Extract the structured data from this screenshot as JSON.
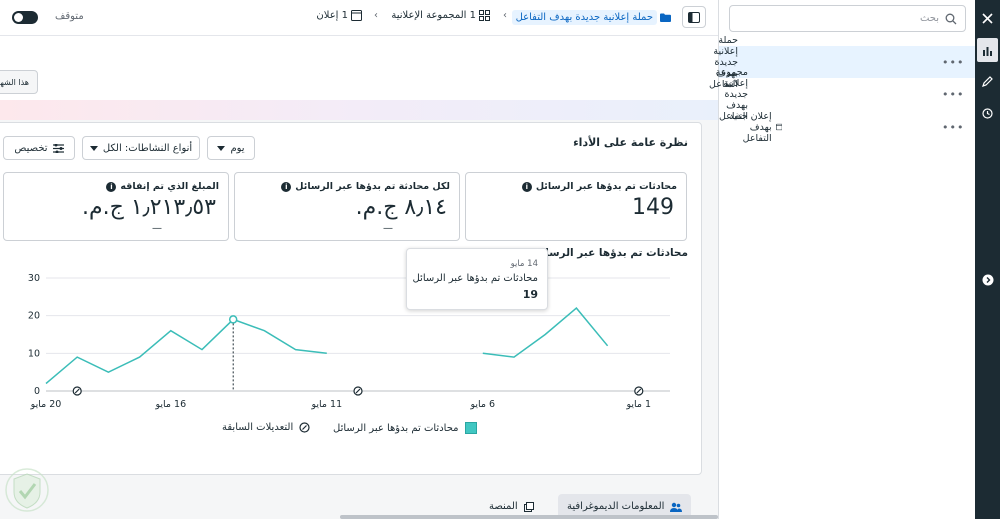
{
  "topbar": {
    "status_label": "متوقف",
    "breadcrumb": {
      "campaign": "حملة إعلانية جديدة بهدف التفاعل",
      "ad_set": "1 المجموعة الإعلانية",
      "ad": "1 إعلان"
    },
    "month_button": "هذا الشهر"
  },
  "nav": {
    "search_placeholder": "بحث",
    "items": [
      {
        "label": "حملة إعلانية جديدة بهدف التفاعل",
        "icon": "folder-icon"
      },
      {
        "label": "مجموعة إعلانية جديدة بهدف التفاعل",
        "icon": "grid-icon"
      },
      {
        "label": "إعلان جديد بهدف التفاعل",
        "icon": "ad-icon"
      }
    ],
    "more_label": "•••"
  },
  "rail": {
    "icons": [
      "close-icon",
      "chart-icon",
      "pencil-icon",
      "clock-icon",
      "expand-icon"
    ]
  },
  "overview": {
    "title": "نظرة عامة على الأداء",
    "day_select": "يوم",
    "activity_select": "أنواع النشاطات: الكل",
    "customize_button": "تخصيص",
    "metrics": [
      {
        "label": "محادثات تم بدؤها عبر الرسائل",
        "value": "149",
        "sub": ""
      },
      {
        "label": "لكل محادثة تم بدؤها عبر الرسائل",
        "value": "٨٫١٤ ج.م.",
        "sub": "—"
      },
      {
        "label": "المبلغ الذي تم إنفاقه",
        "value": "١٫٢١٣٫٥٣ ج.م.",
        "sub": "—"
      }
    ],
    "chart_title": "محادثات تم بدؤها عبر الرسائل",
    "tooltip": {
      "date": "14 مايو",
      "label": "محادثات تم بدؤها عبر الرسائل",
      "value": "19"
    },
    "legend": {
      "series": "محادثات تم بدؤها عبر الرسائل",
      "edits": "التعديلات السابقة"
    }
  },
  "chart_data": {
    "type": "line",
    "title": "محادثات تم بدؤها عبر الرسائل",
    "xlabel": "",
    "ylabel": "",
    "x_ticks": [
      "1 مايو",
      "6 مايو",
      "11 مايو",
      "16 مايو",
      "20 مايو"
    ],
    "y_ticks": [
      0,
      10,
      20,
      30
    ],
    "ylim": [
      0,
      30
    ],
    "x_range": [
      20,
      0
    ],
    "series": [
      {
        "name": "محادثات تم بدؤها عبر الرسائل",
        "color": "#3bbdb8",
        "segments": [
          [
            [
              20,
              2
            ],
            [
              19,
              9
            ],
            [
              18,
              5
            ],
            [
              17,
              9
            ],
            [
              16,
              16
            ],
            [
              15,
              11
            ],
            [
              14,
              19
            ],
            [
              13,
              16
            ],
            [
              12,
              11
            ],
            [
              11,
              10
            ]
          ],
          [
            [
              6,
              10
            ],
            [
              5,
              9
            ],
            [
              4,
              15
            ],
            [
              3,
              22
            ],
            [
              2,
              12
            ]
          ]
        ]
      }
    ],
    "edit_markers_x": [
      19,
      10,
      1
    ],
    "highlight": {
      "x": 14,
      "y": 19
    }
  },
  "bottom_tabs": {
    "demographics": "المعلومات الديموغرافية",
    "platform": "المنصة"
  },
  "colors": {
    "accent": "#0a66c2",
    "line": "#3bbdb8",
    "rail": "#1c2b33"
  }
}
